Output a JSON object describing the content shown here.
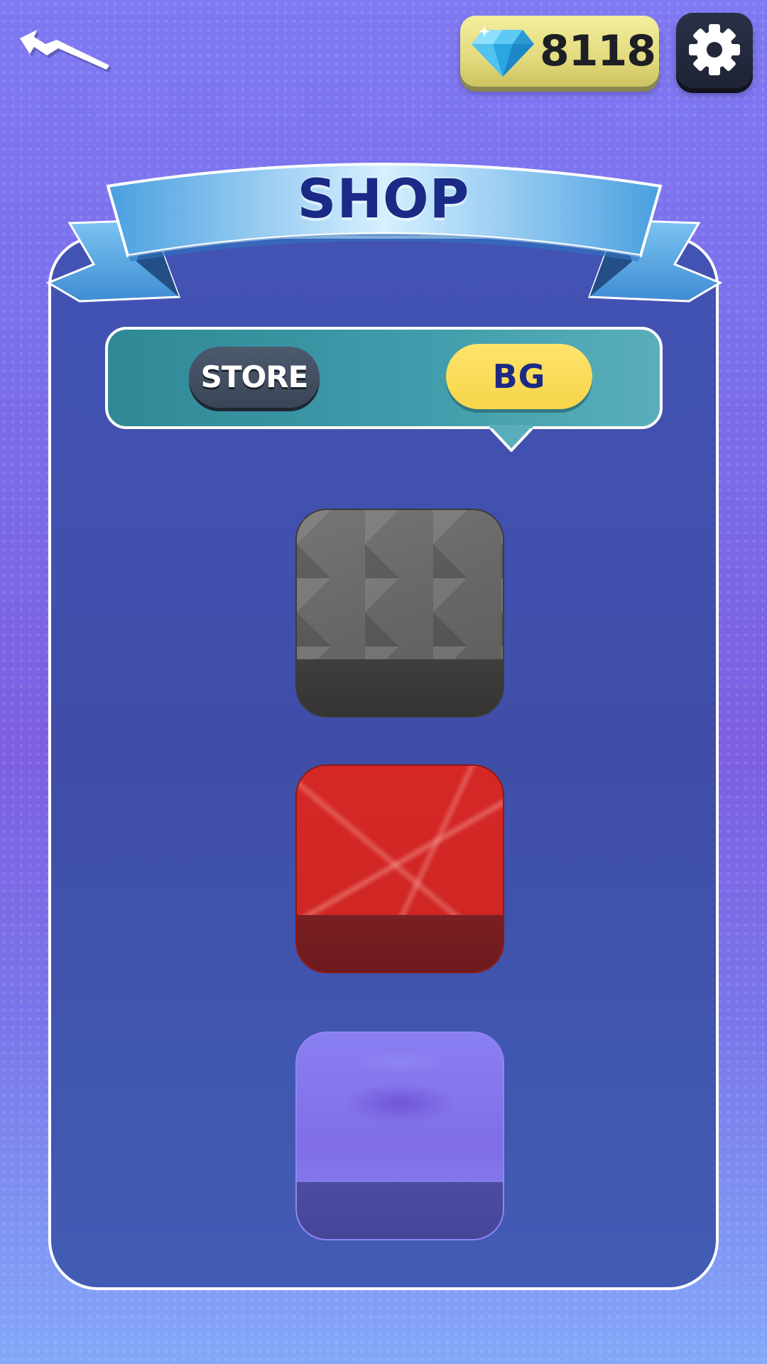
{
  "header": {
    "back_icon": "lightning-back-arrow-icon",
    "gem_icon": "diamond-gem-icon",
    "gem_count": "8118",
    "settings_icon": "gear-icon"
  },
  "shop": {
    "title": "SHOP",
    "tabs": [
      {
        "label": "STORE",
        "selected": false
      },
      {
        "label": "BG",
        "selected": true
      }
    ],
    "backgrounds": [
      {
        "name": "gray-geometric",
        "color": "#6a6866"
      },
      {
        "name": "red-lines",
        "color": "#d12725"
      },
      {
        "name": "purple-glow",
        "color": "#8479ee"
      }
    ]
  },
  "colors": {
    "gem_panel": "#e6dd82",
    "settings_button": "#222839",
    "panel_background": "#4252b0",
    "tab_bar": "#3f9caa",
    "selected_tab": "#fbdc58",
    "unselected_tab": "#434f62",
    "banner_blue": "#6fb8ee"
  }
}
